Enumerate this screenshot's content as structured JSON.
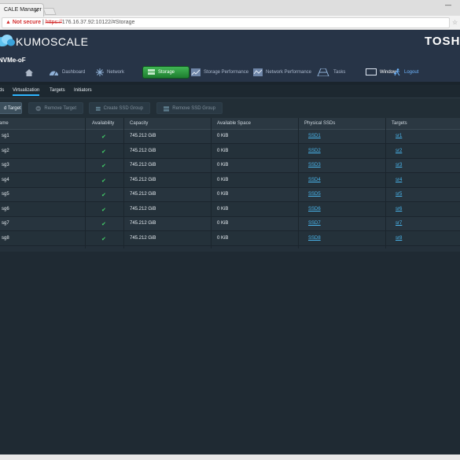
{
  "browser": {
    "tab_title": "CALE Manager",
    "tab_close": "×",
    "warning": "▲ Not secure",
    "url_https": "https://",
    "url_rest": "176.16.37.92:10122/#Storage",
    "star": "☆",
    "minimize": "—"
  },
  "header": {
    "logo_text": "KUMOSCALE",
    "brand": "TOSH",
    "subtitle": "NVMe-oF"
  },
  "nav": {
    "dashboard": "Dashboard",
    "network": "Network",
    "storage": "Storage",
    "storage_performance": "Storage Performance",
    "network_performance": "Network Performance",
    "tasks": "Tasks",
    "window": "Window",
    "logout": "Logout"
  },
  "subtabs": {
    "ds": "ds",
    "virtualization": "Virtualization",
    "targets": "Targets",
    "initiators": "Initiators"
  },
  "actions": {
    "add_target": "d Target",
    "remove_target": "Remove Target",
    "create_ssd_group": "Create SSD Group",
    "remove_ssd_group": "Remove SSD Group"
  },
  "table": {
    "headers": {
      "name": "ame",
      "availability": "Availability",
      "capacity": "Capacity",
      "available_space": "Available Space",
      "physical_ssds": "Physical SSDs",
      "targets": "Targets"
    },
    "rows": [
      {
        "name": "sg1",
        "avail": "✔",
        "capacity": "745.212 GiB",
        "space": "0 KiB",
        "ssd": "SSD1",
        "target": "sr1"
      },
      {
        "name": "sg2",
        "avail": "✔",
        "capacity": "745.212 GiB",
        "space": "0 KiB",
        "ssd": "SSD2",
        "target": "sr2"
      },
      {
        "name": "sg3",
        "avail": "✔",
        "capacity": "745.212 GiB",
        "space": "0 KiB",
        "ssd": "SSD3",
        "target": "sr3"
      },
      {
        "name": "sg4",
        "avail": "✔",
        "capacity": "745.212 GiB",
        "space": "0 KiB",
        "ssd": "SSD4",
        "target": "sr4"
      },
      {
        "name": "sg5",
        "avail": "✔",
        "capacity": "745.212 GiB",
        "space": "0 KiB",
        "ssd": "SSD5",
        "target": "sr5"
      },
      {
        "name": "sg6",
        "avail": "✔",
        "capacity": "745.212 GiB",
        "space": "0 KiB",
        "ssd": "SSD6",
        "target": "sr6"
      },
      {
        "name": "sg7",
        "avail": "✔",
        "capacity": "745.212 GiB",
        "space": "0 KiB",
        "ssd": "SSD7",
        "target": "sr7"
      },
      {
        "name": "sg8",
        "avail": "✔",
        "capacity": "745.212 GiB",
        "space": "0 KiB",
        "ssd": "SSD8",
        "target": "sr8"
      }
    ]
  },
  "colors": {
    "accent_tab": "#2db5ff",
    "storage_active": "#2e9a42",
    "link": "#4ab8f0",
    "check": "#43d36a"
  }
}
